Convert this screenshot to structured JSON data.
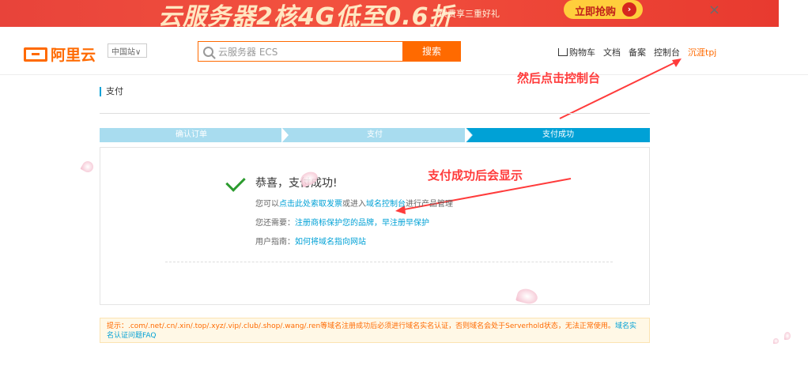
{
  "promo": {
    "title": "云服务器2核4G低至0.6折",
    "subtitle": "续费享三重好礼",
    "button_label": "立即抢购",
    "button_arrow": "›",
    "close_label": "×"
  },
  "header": {
    "logo_text": "阿里云",
    "site_select": "中国站∨",
    "search_placeholder": "云服务器 ECS",
    "search_button": "搜索",
    "nav": {
      "cart": "购物车",
      "docs": "文档",
      "beian": "备案",
      "console": "控制台",
      "user": "沉涯tpj"
    }
  },
  "annotations": {
    "console_hint": "然后点击控制台",
    "success_hint": "支付成功后会显示"
  },
  "breadcrumb": "支付",
  "steps": [
    {
      "label": "确认订单"
    },
    {
      "label": "支付"
    },
    {
      "label": "支付成功"
    }
  ],
  "result": {
    "congrats": "恭喜，支付成功!",
    "line1_prefix": "您可以",
    "line1_link1": "点击此处索取发票",
    "line1_mid": "或进入",
    "line1_link2": "域名控制台",
    "line1_suffix": "进行产品管理",
    "line2_prefix": "您还需要：",
    "line2_link": "注册商标保护您的品牌，早注册早保护",
    "line3_prefix": "用户指南：",
    "line3_link": "如何将域名指向网站"
  },
  "notice": {
    "text": "提示：.com/.net/.cn/.xin/.top/.xyz/.vip/.club/.shop/.wang/.ren等域名注册成功后必须进行域名实名认证，否则域名会处于Serverhold状态，无法正常使用。",
    "link": "域名实名认证问题FAQ"
  },
  "colors": {
    "brand_orange": "#ff6a00",
    "step_active": "#00a1d6",
    "step_inactive": "#a8dcef",
    "annotation_red": "#ff3b3b",
    "success_green": "#2c9b2f"
  }
}
